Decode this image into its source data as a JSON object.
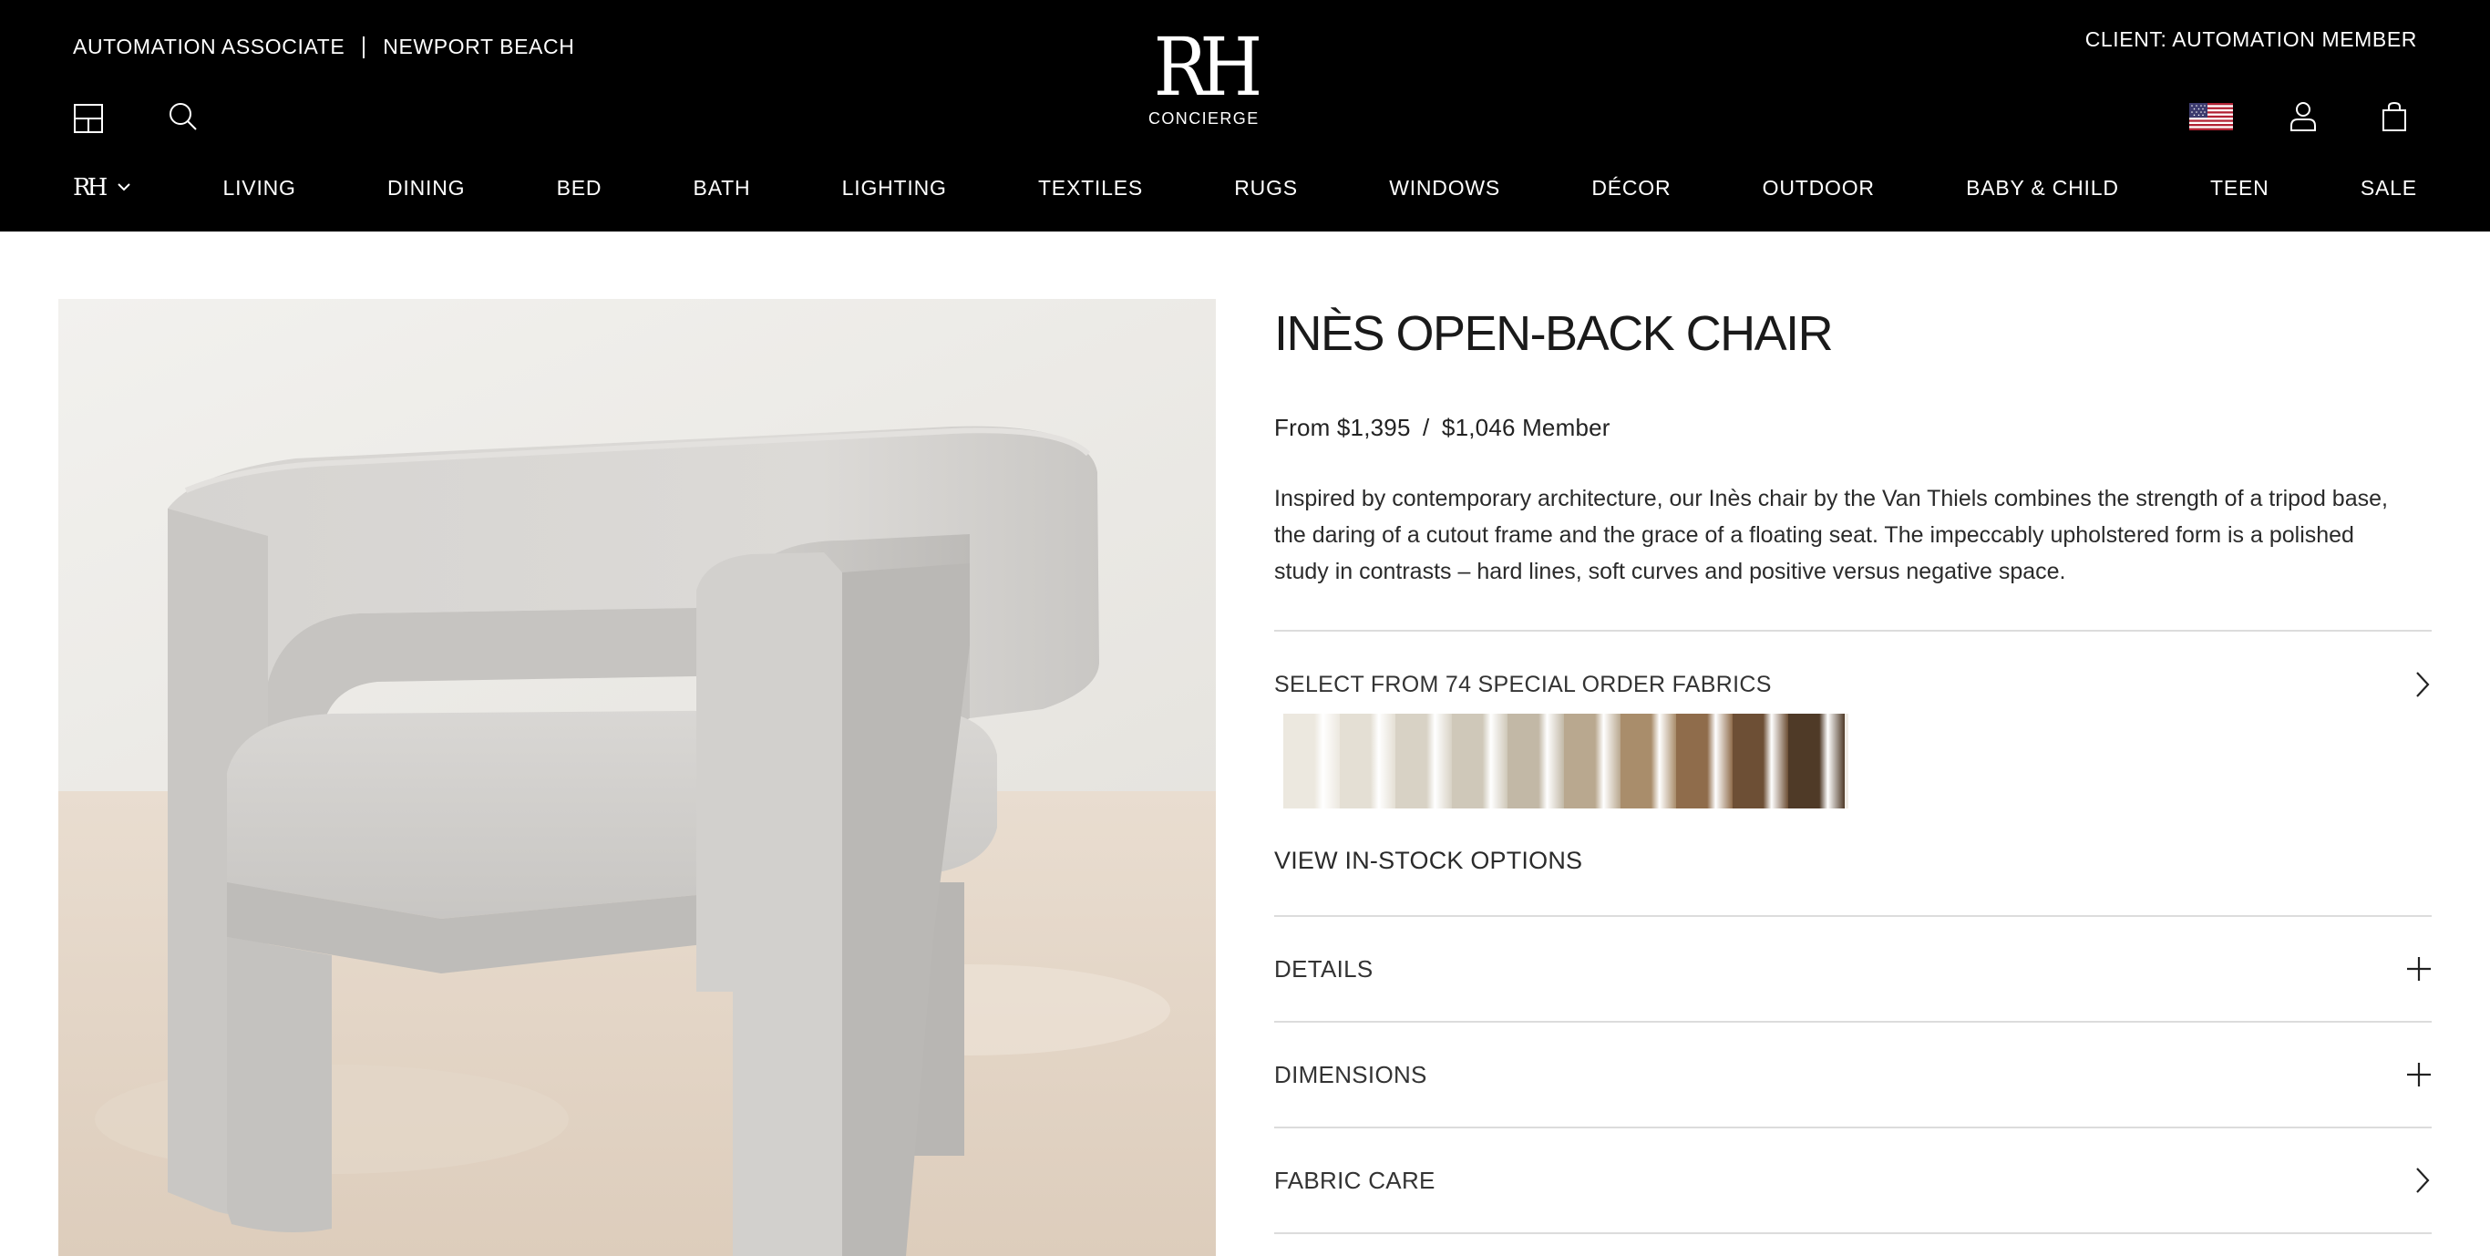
{
  "header": {
    "associate_label": "AUTOMATION ASSOCIATE",
    "location_label": "NEWPORT BEACH",
    "client_label": "CLIENT: AUTOMATION MEMBER",
    "logo_mark": "RH",
    "logo_subtitle": "CONCIERGE",
    "icons": [
      "gallery-icon",
      "search-icon",
      "us-flag-icon",
      "account-icon",
      "cart-icon"
    ],
    "brand_menu_mark": "RH"
  },
  "nav": {
    "items": [
      "LIVING",
      "DINING",
      "BED",
      "BATH",
      "LIGHTING",
      "TEXTILES",
      "RUGS",
      "WINDOWS",
      "DÉCOR",
      "OUTDOOR",
      "BABY & CHILD",
      "TEEN",
      "SALE"
    ]
  },
  "product": {
    "title": "INÈS OPEN-BACK CHAIR",
    "price_regular": "From $1,395",
    "price_separator": "/",
    "price_member": "$1,046 Member",
    "description": "Inspired by contemporary architecture, our Inès chair by the Van Thiels combines the strength of a tripod base, the daring of a cutout frame and the grace of a floating seat. The impeccably upholstered form is a polished study in contrasts – hard lines, soft curves and positive versus negative space.",
    "fabric_label": "SELECT FROM 74 SPECIAL ORDER FABRICS",
    "swatch_colors": [
      "#ece8df",
      "#e4dfd4",
      "#d8d2c5",
      "#cfc8b9",
      "#c2b8a6",
      "#b9a88f",
      "#a98d6b",
      "#8f6c4b",
      "#6d4f35",
      "#4f3a27"
    ],
    "instock_label": "VIEW IN-STOCK OPTIONS",
    "accordions": [
      {
        "label": "DETAILS",
        "control": "plus-icon"
      },
      {
        "label": "DIMENSIONS",
        "control": "plus-icon"
      },
      {
        "label": "FABRIC CARE",
        "control": "chevron-right-icon"
      }
    ]
  },
  "colors": {
    "header_bg": "#000000",
    "header_text": "#ffffff",
    "divider": "#dcdcdc"
  }
}
